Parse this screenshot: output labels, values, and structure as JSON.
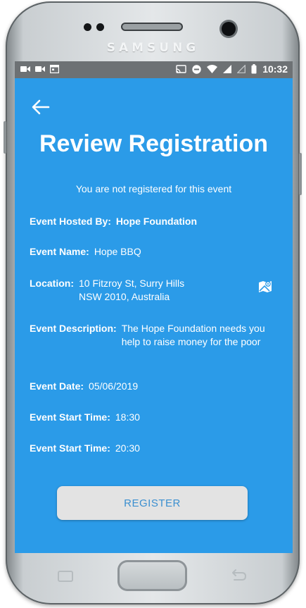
{
  "device": {
    "brand": "SAMSUNG"
  },
  "status_bar": {
    "time": "10:32",
    "left_icons": [
      "video-icon",
      "video-icon",
      "calendar-icon"
    ],
    "right_icons": [
      "cast-icon",
      "do-not-disturb-icon",
      "wifi-icon",
      "signal-icon",
      "signal-empty-icon",
      "battery-icon"
    ]
  },
  "header": {
    "title": "Review Registration"
  },
  "registration_status": "You are not registered for this event",
  "event": {
    "hosted_by_label": "Event Hosted By:",
    "hosted_by": "Hope Foundation",
    "name_label": "Event Name:",
    "name": "Hope BBQ",
    "location_label": "Location:",
    "location": "10 Fitzroy St, Surry Hills NSW 2010, Australia",
    "description_label": "Event Description:",
    "description": "The Hope Foundation needs you help to raise money for the poor",
    "date_label": "Event Date:",
    "date": "05/06/2019",
    "start_label": "Event Start Time:",
    "start": "18:30",
    "end_label": "Event Start Time:",
    "end": "20:30"
  },
  "actions": {
    "register_label": "REGISTER"
  },
  "colors": {
    "screen_background": "#2b9be8",
    "status_bar": "#6d7174",
    "button_background": "#e3e3e3",
    "button_text": "#3b8fd0"
  }
}
